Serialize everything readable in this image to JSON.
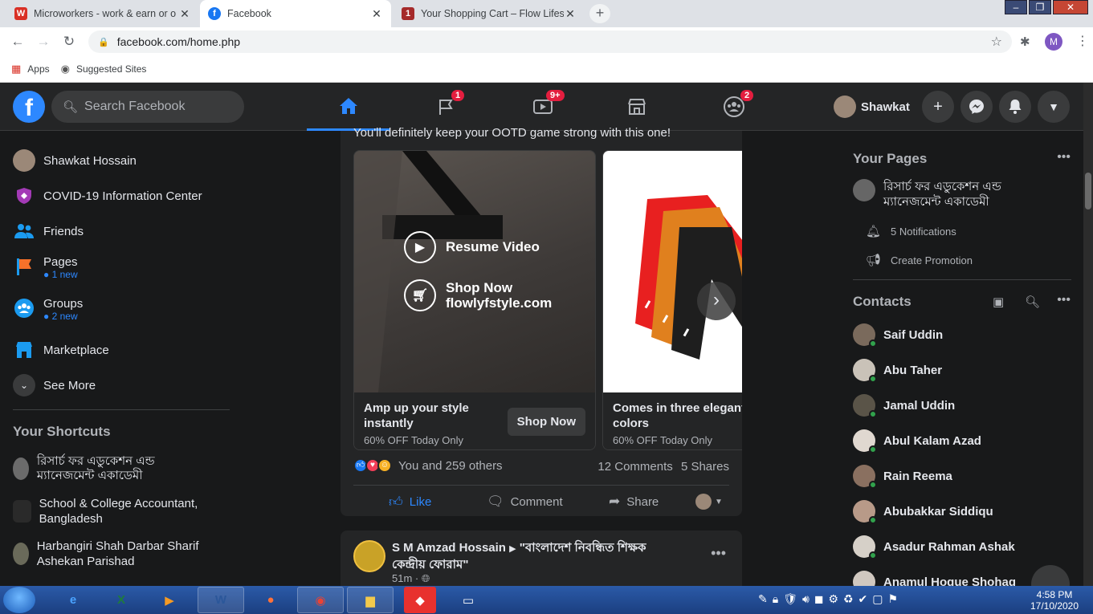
{
  "browser": {
    "tabs": [
      {
        "title": "Microworkers - work & earn or o",
        "favicon": "W"
      },
      {
        "title": "Facebook",
        "favicon": "f"
      },
      {
        "title": "Your Shopping Cart – Flow Lifest",
        "favicon": "1"
      }
    ],
    "url": "facebook.com/home.php",
    "profile_initial": "M",
    "bookmarks": [
      "Apps",
      "Suggested Sites"
    ]
  },
  "header": {
    "search_placeholder": "Search Facebook",
    "user_name": "Shawkat",
    "badges": {
      "pages": "1",
      "watch": "9+",
      "groups": "2"
    }
  },
  "left_nav": {
    "items": [
      {
        "label": "Shawkat Hossain"
      },
      {
        "label": "COVID-19 Information Center"
      },
      {
        "label": "Friends"
      },
      {
        "label": "Pages",
        "sub": "● 1 new"
      },
      {
        "label": "Groups",
        "sub": "● 2 new"
      },
      {
        "label": "Marketplace"
      },
      {
        "label": "See More"
      }
    ],
    "shortcuts_title": "Your Shortcuts",
    "shortcuts": [
      "রিসার্চ ফর এডুকেশন এন্ড ম্যানেজমেন্ট একাডেমী",
      "School & College Accountant, Bangladesh",
      "Harbangiri Shah Darbar Sharif Ashekan Parishad"
    ]
  },
  "feed": {
    "caption": "You'll definitely keep your OOTD game strong with this one!",
    "overlay_resume": "Resume Video",
    "overlay_shop": "Shop Now",
    "overlay_site": "flowlyfstyle.com",
    "cards": [
      {
        "title": "Amp up your style instantly",
        "sub": "60% OFF Today Only",
        "cta": "Shop Now"
      },
      {
        "title": "Comes in three elegant colors",
        "sub": "60% OFF Today Only"
      }
    ],
    "reactions_text": "You and 259 others",
    "comments": "12 Comments",
    "shares": "5 Shares",
    "actions": {
      "like": "Like",
      "comment": "Comment",
      "share": "Share"
    },
    "next_post": {
      "author": "S M Amzad Hossain",
      "group": "\"বাংলাদেশ নিবন্ধিত শিক্ষক কেন্দ্রীয় ফোরাম\"",
      "time": "51m · "
    }
  },
  "right_rail": {
    "pages_title": "Your Pages",
    "page_name": "রিসার্চ ফর এডুকেশন এন্ড ম্যানেজমেন্ট একাডেমী",
    "notifications": "5 Notifications",
    "create_promotion": "Create Promotion",
    "contacts_title": "Contacts",
    "contacts": [
      "Saif Uddin",
      "Abu Taher",
      "Jamal Uddin",
      "Abul Kalam Azad",
      "Rain Reema",
      "Abubakkar Siddiqu",
      "Asadur Rahman Ashak",
      "Anamul Hoque Shohag"
    ]
  },
  "taskbar": {
    "time": "4:58 PM",
    "date": "17/10/2020"
  },
  "colors": {
    "fb_blue": "#2d88ff",
    "badge_red": "#e41e3f",
    "online_green": "#31a24c"
  }
}
